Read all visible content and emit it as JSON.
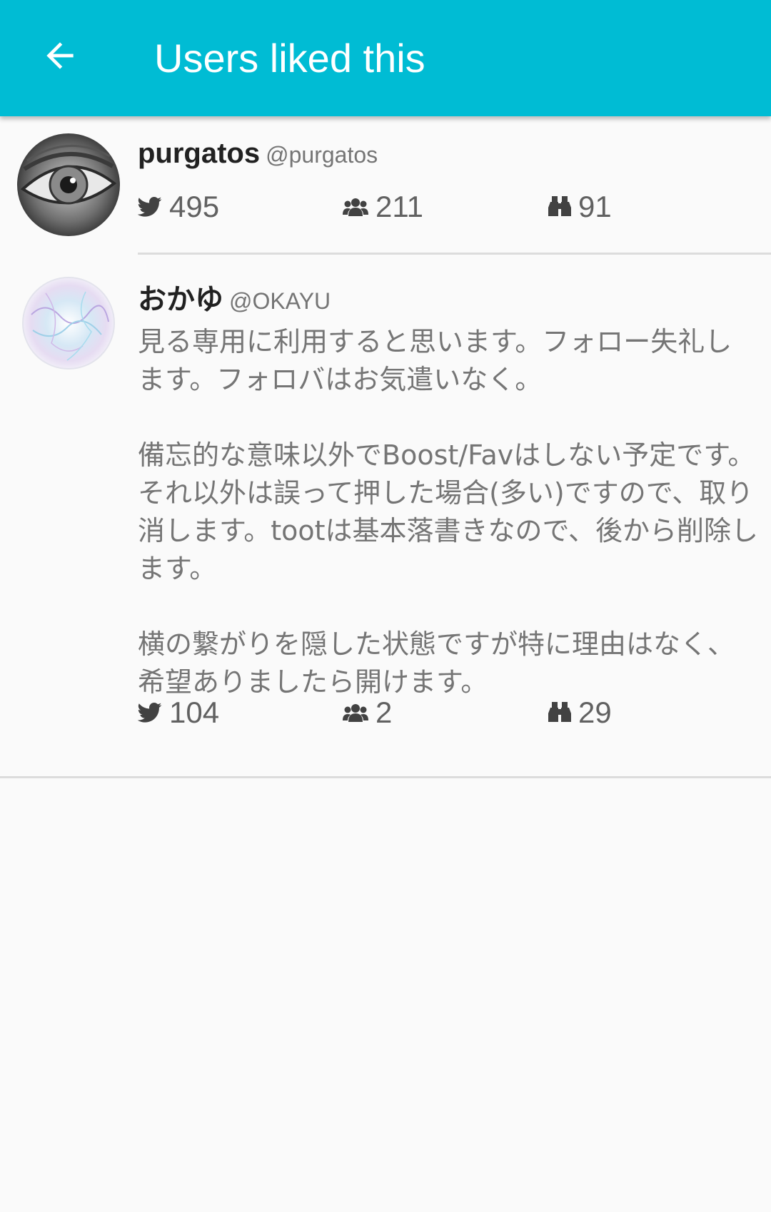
{
  "appbar": {
    "title": "Users liked this",
    "back_icon": "arrow-left-icon",
    "color": "#00bcd4"
  },
  "users": [
    {
      "display_name": "purgatos",
      "acct": "@purgatos",
      "note": "",
      "statuses": "495",
      "following": "211",
      "followers": "91"
    },
    {
      "display_name": "おかゆ",
      "acct": "@OKAYU",
      "note": "見る専用に利用すると思います。フォロー失礼します。フォロバはお気遣いなく。\n\n備忘的な意味以外でBoost/Favはしない予定です。それ以外は誤って押した場合(多い)ですので、取り消します。tootは基本落書きなので、後から削除します。\n\n横の繋がりを隠した状態ですが特に理由はなく、希望ありましたら開けます。",
      "statuses": "104",
      "following": "2",
      "followers": "29"
    }
  ],
  "icons": {
    "statuses": "twitter-bird-icon",
    "following": "users-group-icon",
    "followers": "binoculars-icon"
  }
}
